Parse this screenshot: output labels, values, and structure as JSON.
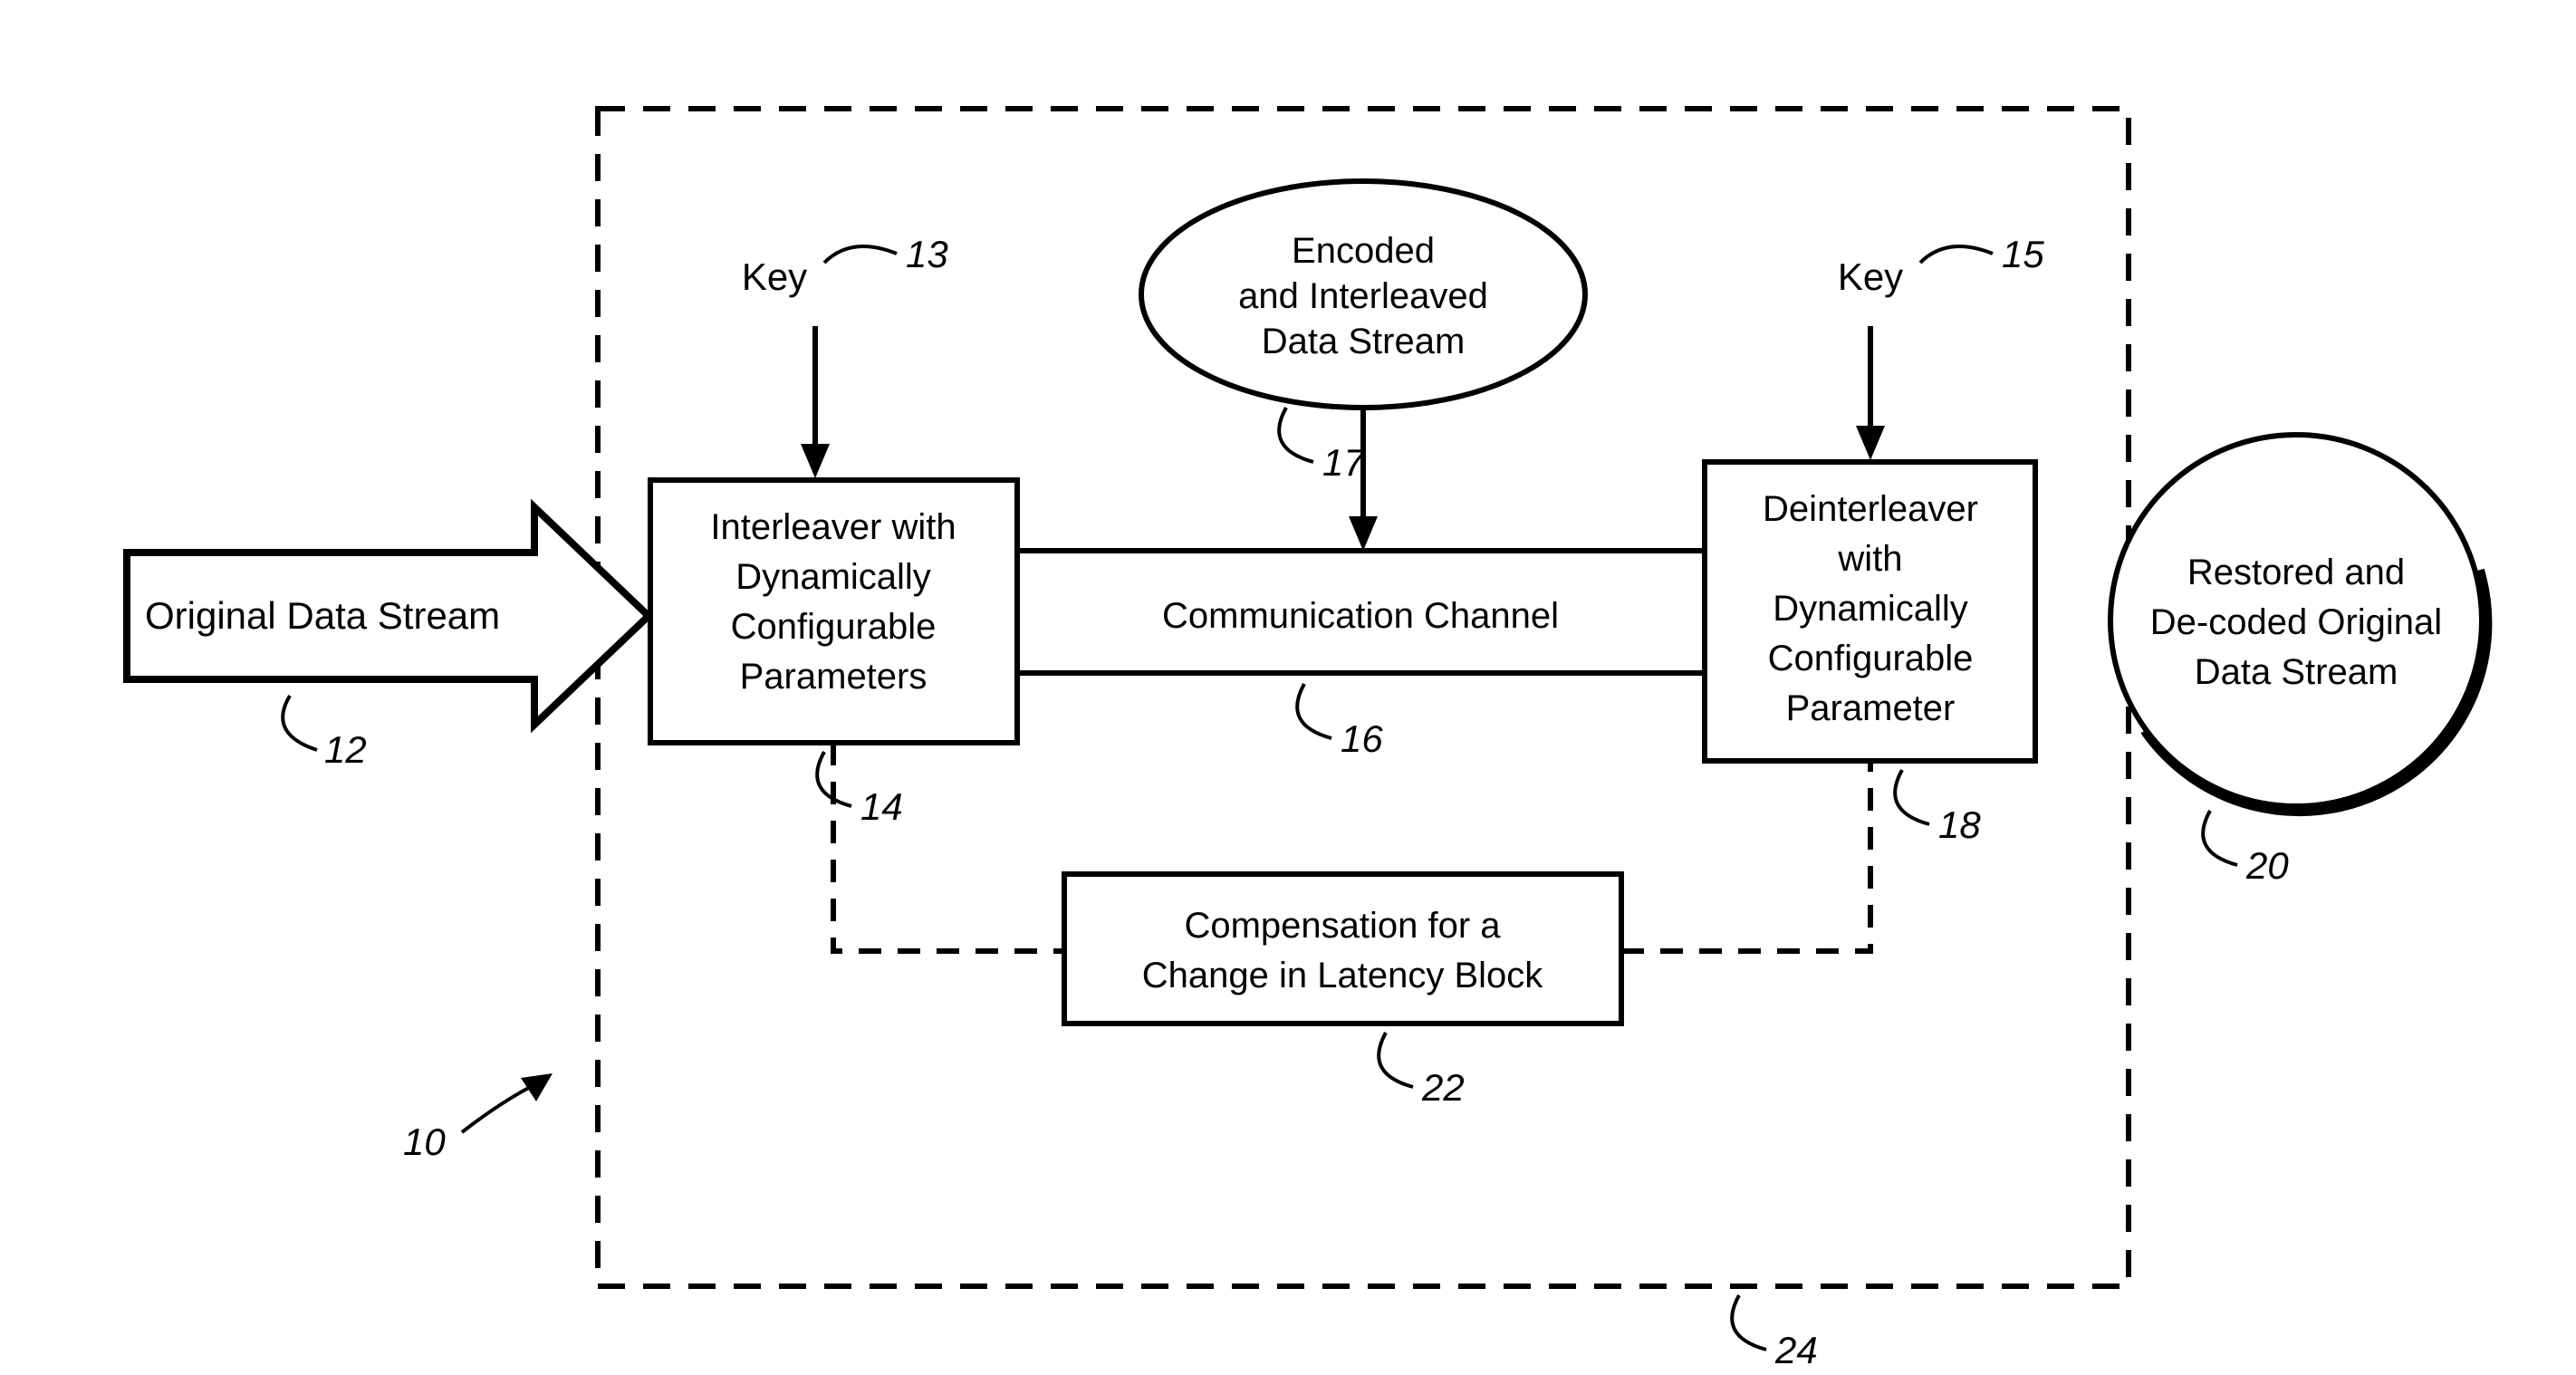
{
  "inputLabel": "Original Data Stream",
  "key13": {
    "label": "Key",
    "ref": "13"
  },
  "key15": {
    "label": "Key",
    "ref": "15"
  },
  "interleaver": {
    "l1": "Interleaver with",
    "l2": "Dynamically",
    "l3": "Configurable",
    "l4": "Parameters",
    "ref": "14"
  },
  "channel": {
    "label": "Communication Channel",
    "ref": "16"
  },
  "encoded": {
    "l1": "Encoded",
    "l2": "and Interleaved",
    "l3": "Data Stream",
    "ref": "17"
  },
  "deinterleaver": {
    "l1": "Deinterleaver",
    "l2": "with",
    "l3": "Dynamically",
    "l4": "Configurable",
    "l5": "Parameter",
    "ref": "18"
  },
  "restored": {
    "l1": "Restored and",
    "l2": "De-coded Original",
    "l3": "Data Stream",
    "ref": "20"
  },
  "compensation": {
    "l1": "Compensation for a",
    "l2": "Change in Latency Block",
    "ref": "22"
  },
  "systemRef": "10",
  "boundaryRef": "24",
  "inputRef": "12"
}
